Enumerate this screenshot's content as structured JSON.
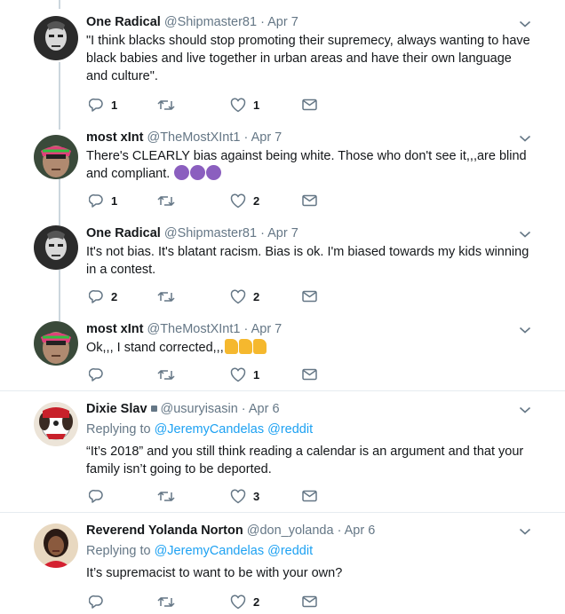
{
  "tweets": [
    {
      "display_name": "One Radical",
      "handle": "@Shipmaster81",
      "date": "Apr 7",
      "text": "\"I think blacks should stop promoting their supremecy, always wanting to have black babies and live together in urban areas and have their own language and culture\".",
      "reply_count": "1",
      "retweet_count": "",
      "like_count": "1"
    },
    {
      "display_name": "most xInt",
      "handle": "@TheMostXInt1",
      "date": "Apr 7",
      "text": "There's CLEARLY bias against being white.  Those who don't see it,,,are blind and compliant.",
      "reply_count": "1",
      "retweet_count": "",
      "like_count": "2"
    },
    {
      "display_name": "One Radical",
      "handle": "@Shipmaster81",
      "date": "Apr 7",
      "text": "It's not bias. It's blatant racism. Bias is ok. I'm biased towards my kids winning in a contest.",
      "reply_count": "2",
      "retweet_count": "",
      "like_count": "2"
    },
    {
      "display_name": "most xInt",
      "handle": "@TheMostXInt1",
      "date": "Apr 7",
      "text": "Ok,,, I stand corrected,,,",
      "reply_count": "",
      "retweet_count": "",
      "like_count": "1"
    },
    {
      "display_name": "Dixie Slav",
      "handle": "@usuryisasin",
      "date": "Apr 6",
      "replying_prefix": "Replying to",
      "replying_mentions": "@JeremyCandelas @reddit",
      "text": "“It’s 2018” and you still think reading a calendar is an argument and that your family isn’t going to be deported.",
      "reply_count": "",
      "retweet_count": "",
      "like_count": "3"
    },
    {
      "display_name": "Reverend Yolanda Norton",
      "handle": "@don_yolanda",
      "date": "Apr 6",
      "replying_prefix": "Replying to",
      "replying_mentions": "@JeremyCandelas @reddit",
      "text": "It’s supremacist to want to be with your own?",
      "reply_count": "",
      "retweet_count": "",
      "like_count": "2"
    }
  ],
  "date_separator": "·",
  "colors": {
    "text": "#14171a",
    "muted": "#657786",
    "link": "#1da1f2",
    "divider": "#e6ecf0",
    "thread_line": "#ccd6dd"
  }
}
